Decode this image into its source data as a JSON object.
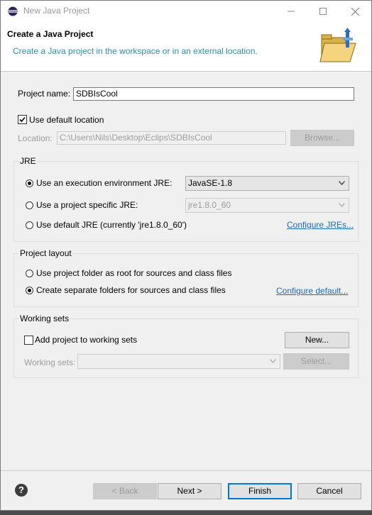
{
  "window": {
    "title": "New Java Project",
    "minimize_icon": "minimize-icon",
    "maximize_icon": "maximize-icon",
    "close_icon": "close-icon"
  },
  "banner": {
    "title": "Create a Java Project",
    "description": "Create a Java project in the workspace or in an external location.",
    "icon": "folder-icon"
  },
  "project": {
    "name_label": "Project name:",
    "name_value": "SDBIsCool"
  },
  "location": {
    "use_default_label": "Use default location",
    "use_default_checked": true,
    "label": "Location:",
    "value": "C:\\Users\\Nils\\Desktop\\Eclips\\SDBIsCool",
    "browse_label": "Browse..."
  },
  "jre": {
    "group_label": "JRE",
    "option_env_label": "Use an execution environment JRE:",
    "option_env_value": "JavaSE-1.8",
    "option_specific_label": "Use a project specific JRE:",
    "option_specific_value": "jre1.8.0_60",
    "option_default_label": "Use default JRE (currently 'jre1.8.0_60')",
    "configure_link": "Configure JREs...",
    "selected": "env"
  },
  "layout": {
    "group_label": "Project layout",
    "option_root_label": "Use project folder as root for sources and class files",
    "option_separate_label": "Create separate folders for sources and class files",
    "configure_link": "Configure default...",
    "selected": "separate"
  },
  "working_sets": {
    "group_label": "Working sets",
    "add_label": "Add project to working sets",
    "add_checked": false,
    "new_label": "New...",
    "sets_label": "Working sets:",
    "select_label": "Select..."
  },
  "footer": {
    "help_icon": "help-icon",
    "help_glyph": "?",
    "back_label": "< Back",
    "next_label": "Next >",
    "finish_label": "Finish",
    "cancel_label": "Cancel"
  },
  "colors": {
    "accent": "#0078d7",
    "link": "#1a69b8",
    "banner_description": "#2e8fa0"
  }
}
